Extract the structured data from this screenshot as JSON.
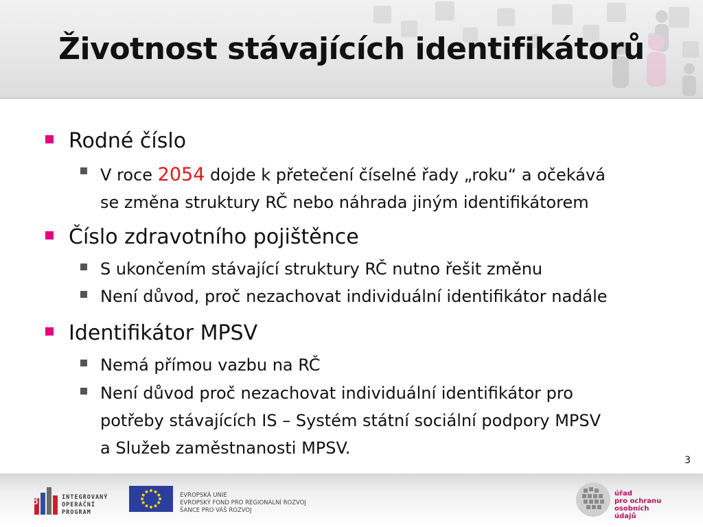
{
  "slide": {
    "title": "Životnost stávajících identifikátorů",
    "page_number": "3"
  },
  "bullets": [
    {
      "label": "Rodné číslo",
      "sub": [
        {
          "pre": "V roce ",
          "highlight": "2054",
          "post": " dojde k přetečení číselné řady „roku“ a očekává",
          "line2": "se změna struktury RČ nebo náhrada jiným identifikátorem"
        }
      ]
    },
    {
      "label": "Číslo zdravotního pojištěnce",
      "sub": [
        {
          "text": "S ukončením stávající struktury RČ nutno řešit změnu"
        },
        {
          "text": "Není důvod, proč  nezachovat individuální identifikátor nadále"
        }
      ]
    },
    {
      "label": "Identifikátor MPSV",
      "sub": [
        {
          "text": "Nemá  přímou vazbu na RČ"
        },
        {
          "line1": "Není důvod proč nezachovat individuální identifikátor pro",
          "line2": "potřeby stávajících IS – Systém státní sociální podpory MPSV",
          "line3": "a Služeb zaměstnanosti MPSV."
        }
      ]
    }
  ],
  "footer": {
    "slide_number": "3",
    "iop_logo": [
      "INTEGROVANÝ",
      "OPERAČNÍ",
      "PROGRAM"
    ],
    "eu_text": [
      "EVROPSKÁ UNIE",
      "EVROPSKÝ FOND PRO REGIONÁLNÍ ROZVOJ",
      "ŠANCE PRO VÁŠ ROZVOJ"
    ],
    "uoou_text": [
      "úřad",
      "pro ochranu",
      "osobních",
      "údajů"
    ]
  },
  "colors": {
    "bullet_level1": "#e6007e",
    "bullet_level2": "#555555",
    "highlight": "#e11a1a",
    "uoou_brand": "#b2125c"
  }
}
